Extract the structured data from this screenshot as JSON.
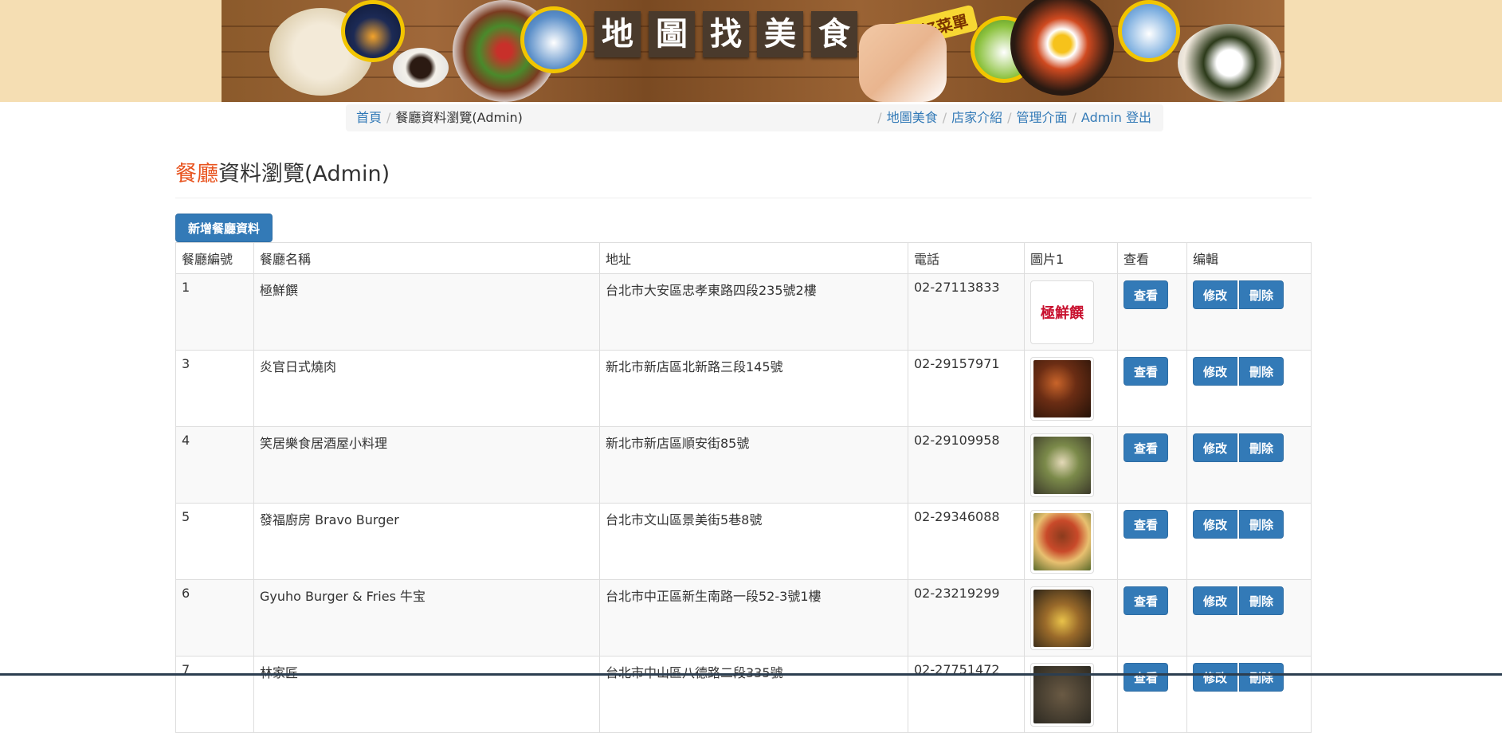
{
  "header": {
    "title_chars": [
      "地",
      "圖",
      "找",
      "美",
      "食"
    ],
    "slogan": "找吃的好菜單",
    "colors": {
      "banner_bg": "#f5deb3",
      "pin_border": "#f2c500"
    }
  },
  "breadcrumb": {
    "home": "首頁",
    "current": "餐廳資料瀏覽(Admin)",
    "links": [
      "地圖美食",
      "店家介紹",
      "管理介面",
      "Admin 登出"
    ]
  },
  "page": {
    "title_accent": "餐廳",
    "title_rest": "資料瀏覽(Admin)",
    "add_button": "新增餐廳資料",
    "accent_color": "#e8531e",
    "primary_color": "#337ab7"
  },
  "table": {
    "columns": [
      "餐廳編號",
      "餐廳名稱",
      "地址",
      "電話",
      "圖片1",
      "查看",
      "编輯"
    ],
    "view_label": "查看",
    "edit_label": "修改",
    "delete_label": "刪除",
    "rows": [
      {
        "id": "1",
        "name": "極鮮饌",
        "address": "台北市大安區忠孝東路四段235號2樓",
        "phone": "02-27113833",
        "image_icon": "logo-image",
        "logo_text": "極鮮饌"
      },
      {
        "id": "3",
        "name": "炎官日式燒肉",
        "address": "新北市新店區北新路三段145號",
        "phone": "02-29157971",
        "image_icon": "food-photo"
      },
      {
        "id": "4",
        "name": "笑居樂食居酒屋小料理",
        "address": "新北市新店區順安街85號",
        "phone": "02-29109958",
        "image_icon": "food-photo"
      },
      {
        "id": "5",
        "name": "發福廚房 Bravo Burger",
        "address": "台北市文山區景美街5巷8號",
        "phone": "02-29346088",
        "image_icon": "food-photo"
      },
      {
        "id": "6",
        "name": "Gyuho Burger & Fries 牛宝",
        "address": "台北市中正區新生南路一段52-3號1樓",
        "phone": "02-23219299",
        "image_icon": "food-photo"
      },
      {
        "id": "7",
        "name": "林家匠",
        "address": "台北市中山區八德路二段335號",
        "phone": "02-27751472",
        "image_icon": "food-photo"
      }
    ]
  }
}
